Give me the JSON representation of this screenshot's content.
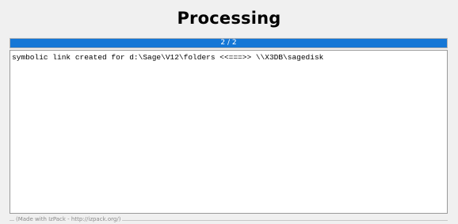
{
  "header": {
    "title": "Processing"
  },
  "progress": {
    "text": "2 / 2",
    "fraction": 1.0,
    "color": "#1577d6"
  },
  "log": {
    "lines": [
      "symbolic link created for d:\\Sage\\V12\\folders <<===>> \\\\X3DB\\sagedisk"
    ]
  },
  "footer": {
    "credit": "(Made with IzPack - http://izpack.org/)"
  }
}
